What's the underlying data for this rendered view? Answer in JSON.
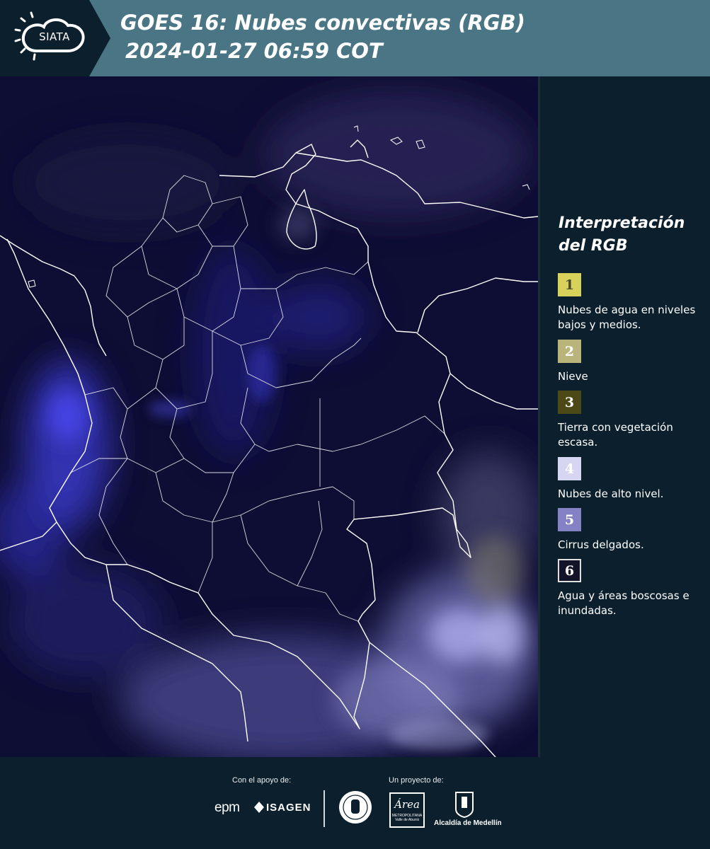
{
  "header": {
    "logo_text": "SIATA",
    "title_line1": "GOES 16: Nubes convectivas (RGB)",
    "title_line2": "2024-01-27 06:59 COT"
  },
  "map": {
    "region": "Colombia",
    "background_color": "#0e0d33",
    "border_color": "#ffffff"
  },
  "legend": {
    "title": "Interpretación del RGB",
    "items": [
      {
        "number": "1",
        "label": "Nubes de agua en niveles bajos y medios.",
        "color": "#d9d25a",
        "text_color": "#4a4a2a"
      },
      {
        "number": "2",
        "label": "Nieve",
        "color": "#b9b57a",
        "text_color": "#ffffff"
      },
      {
        "number": "3",
        "label": "Tierra con vegetación escasa.",
        "color": "#4d4916",
        "text_color": "#ffffff"
      },
      {
        "number": "4",
        "label": "Nubes de alto nivel.",
        "color": "#d6d6f2",
        "text_color": "#ffffff"
      },
      {
        "number": "5",
        "label": "Cirrus delgados.",
        "color": "#8481c4",
        "text_color": "#ffffff"
      },
      {
        "number": "6",
        "label": "Agua y áreas boscosas e inundadas.",
        "color": "#13142a",
        "text_color": "#ffffff"
      }
    ]
  },
  "footer": {
    "support_caption": "Con el apoyo de:",
    "project_caption": "Un proyecto de:",
    "sponsor_epm": "epm",
    "sponsor_isagen": "ISAGEN",
    "area_logo_word": "Área",
    "area_logo_sub": "METROPOLITANA Valle de Aburrá",
    "alcaldia_label": "Alcaldía de Medellín"
  }
}
